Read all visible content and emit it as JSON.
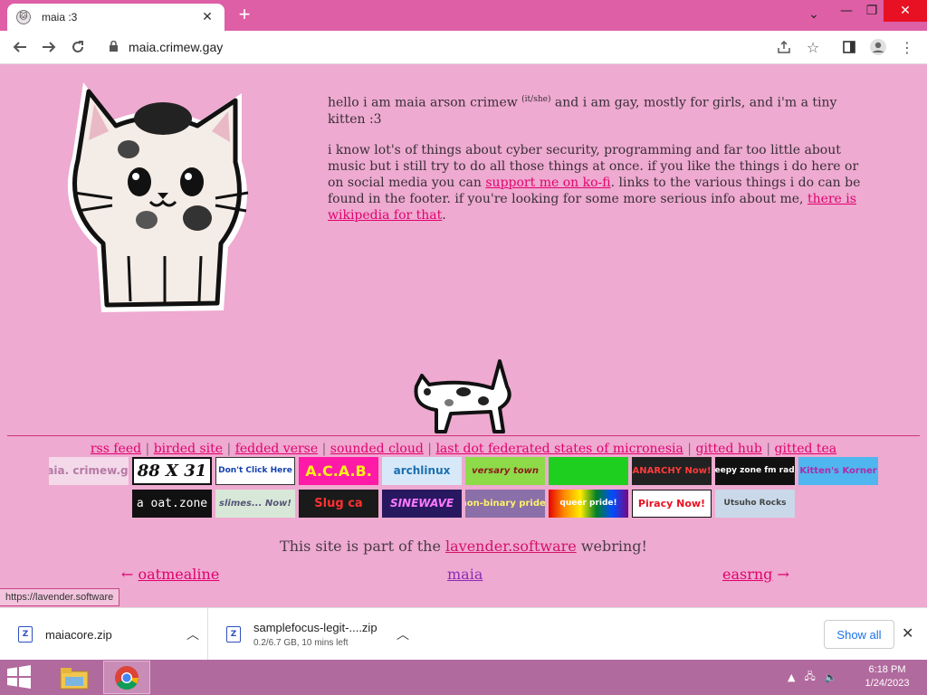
{
  "browser": {
    "tab_title": "maia :3",
    "url": "maia.crimew.gay",
    "colors": {
      "frame": "#de5fa6",
      "close": "#e81123"
    }
  },
  "page": {
    "bg_color": "#eeaad0",
    "link_color": "#e2006e",
    "intro1_a": "hello i am maia arson crimew",
    "intro1_pronouns": "(it/she)",
    "intro1_b": "and i am gay, mostly for girls, and i'm a tiny kitten :3",
    "intro2_a": "i know lot's of things about cyber security, programming and far too little about music but i still try to do all those things at once. if you like the things i do here or on social media you can",
    "intro2_link1": "support me on ko-fi",
    "intro2_b": ". links to the various things i do can be found in the footer. if you're looking for some more serious info about me,",
    "intro2_link2": "there is wikipedia for that",
    "intro2_c": ".",
    "footer_links": [
      "rss feed",
      "birded site",
      "fedded verse",
      "sounded cloud",
      "last dot federated states of micronesia",
      "gitted hub",
      "gitted tea"
    ],
    "buttons_row1": [
      "maia. crimew.gay",
      "88 X 31",
      "Don't Click Here",
      "A.C.A.B.",
      "archlinux",
      "versary town",
      "",
      "ANARCHY Now!",
      "sleepy zone fm radio",
      "Kitten's Korner"
    ],
    "buttons_row2": [
      "a oat.zone",
      "slimes... Now!",
      "Slug ca",
      "SINEWAVE",
      "non-binary pride!",
      "queer pride!",
      "Piracy Now!",
      "Utsuho Rocks"
    ],
    "webring_a": "This site is part of the",
    "webring_link": "lavender.software",
    "webring_b": "webring!",
    "ring_prev_arrow": "←",
    "ring_prev": "oatmealine",
    "ring_cur": "maia",
    "ring_next": "easrng",
    "ring_next_arrow": "→"
  },
  "status_url": "https://lavender.software",
  "downloads": [
    {
      "name": "maiacore.zip",
      "detail": ""
    },
    {
      "name": "samplefocus-legit-....zip",
      "detail": "0.2/6.7 GB, 10 mins left"
    }
  ],
  "show_all": "Show all",
  "taskbar": {
    "time": "6:18 PM",
    "date": "1/24/2023"
  }
}
